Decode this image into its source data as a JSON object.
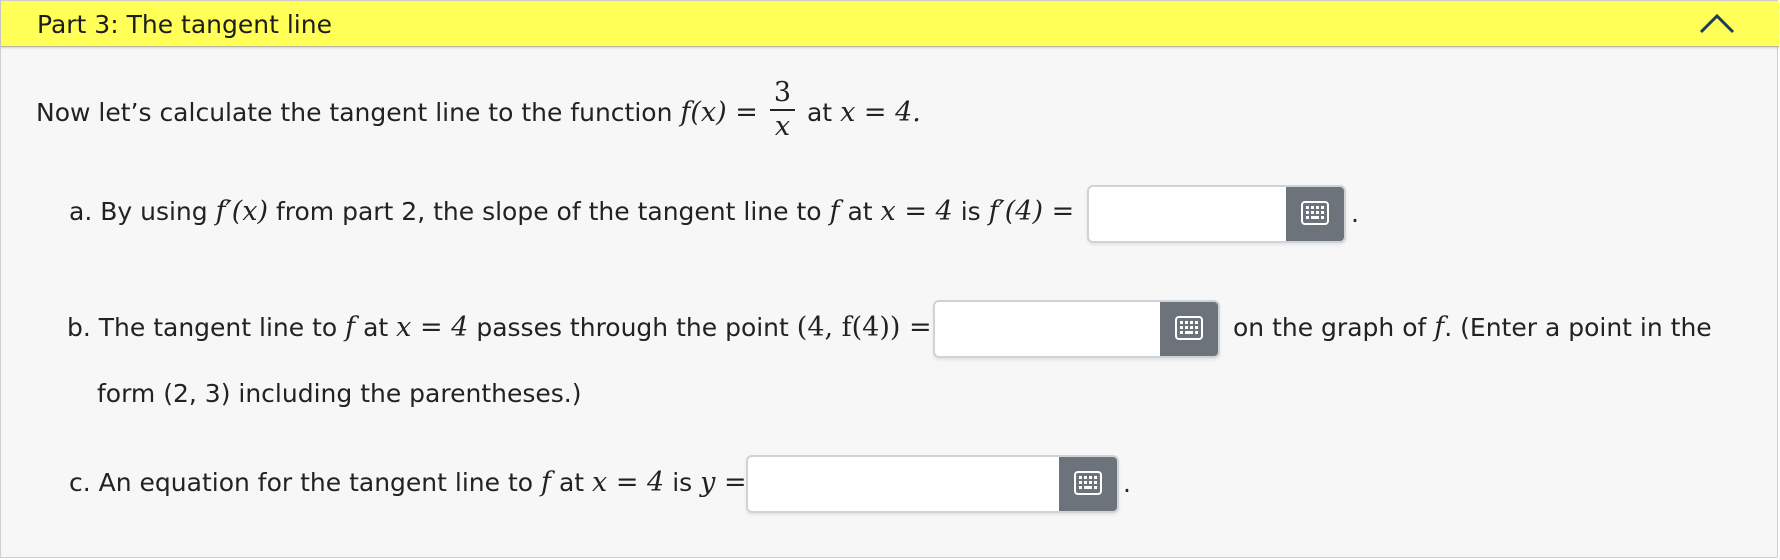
{
  "header": {
    "title": "Part 3: The tangent line"
  },
  "intro": {
    "prefix": "Now let’s calculate the tangent line to the function",
    "func_lhs": "f(x) =",
    "numerator": "3",
    "denominator": "x",
    "at_word": "at",
    "at_expr": "x = 4."
  },
  "part_a": {
    "label": "a. By using",
    "fprime": "f′(x)",
    "middle": "from part 2, the slope of the tangent line to",
    "f": "f",
    "at_word": "at",
    "at_expr": "x = 4",
    "is_word": "is",
    "lhs": "f′(4) =",
    "input_value": "",
    "period": "."
  },
  "part_b": {
    "label": "b. The tangent line to",
    "f": "f",
    "at_word": "at",
    "at_expr": "x = 4",
    "middle": "passes through the point",
    "lhs": "(4, f(4)) =",
    "input_value": "",
    "after": "on the graph of",
    "f2": "f",
    "after2": ". (Enter a point in the",
    "line2": "form (2, 3) including the parentheses.)"
  },
  "part_c": {
    "label": "c. An equation for the tangent line to",
    "f": "f",
    "at_word": "at",
    "at_expr": "x = 4",
    "is_word": "is",
    "lhs": "y =",
    "input_value": "",
    "period": "."
  },
  "icons": {
    "collapse": "chevron-up-icon",
    "keyboard": "keyboard-icon"
  },
  "colors": {
    "header_bg": "#ffff57",
    "keyboard_button": "#6c737b"
  }
}
